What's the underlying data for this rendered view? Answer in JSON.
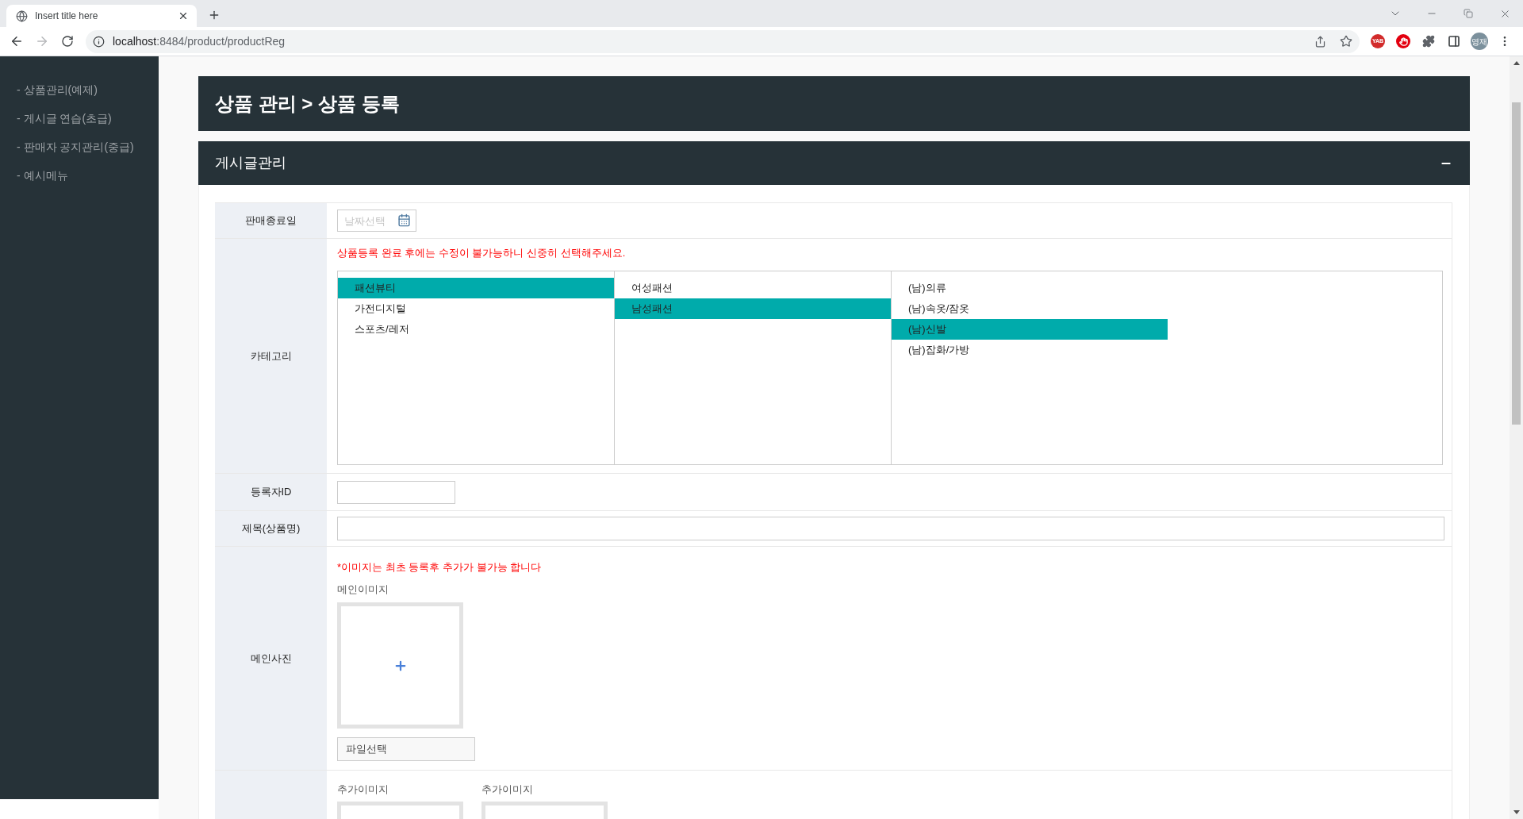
{
  "browser": {
    "tab_title": "Insert title here",
    "url_host": "localhost",
    "url_path": ":8484/product/productReg",
    "forward_disabled": true,
    "extension_badge": "YAB",
    "profile_initials": "영재"
  },
  "sidebar": {
    "items": [
      {
        "label": "- 상품관리(예제)"
      },
      {
        "label": "- 게시글 연습(초급)"
      },
      {
        "label": "- 판매자 공지관리(중급)"
      },
      {
        "label": "- 예시메뉴"
      }
    ]
  },
  "page_title": "상품 관리 > 상품 등록",
  "panel": {
    "title": "게시글관리",
    "expanded": true
  },
  "form": {
    "rows": [
      {
        "kind": "date",
        "label": "판매종료일",
        "placeholder": "날짜선택"
      },
      {
        "kind": "category",
        "label": "카테고리",
        "notice": "상품등록 완료 후에는 수정이 불가능하니 신중히 선택해주세요.",
        "columns": [
          {
            "items": [
              {
                "label": "패션뷰티",
                "selected": true
              },
              {
                "label": "가전디지털",
                "selected": false
              },
              {
                "label": "스포츠/레저",
                "selected": false
              }
            ]
          },
          {
            "items": [
              {
                "label": "여성패션",
                "selected": false
              },
              {
                "label": "남성패션",
                "selected": true
              }
            ]
          },
          {
            "items": [
              {
                "label": "(남)의류",
                "selected": false
              },
              {
                "label": "(남)속옷/잠옷",
                "selected": false
              },
              {
                "label": "(남)신발",
                "selected": true
              },
              {
                "label": "(남)잡화/가방",
                "selected": false
              }
            ]
          }
        ]
      },
      {
        "kind": "short_input",
        "label": "등록자ID"
      },
      {
        "kind": "input",
        "label": "제목(상품명)"
      },
      {
        "kind": "main_image",
        "label": "메인사진",
        "notice": "*이미지는 최초 등록후 추가가 불가능 합니다",
        "image_label": "메인이미지",
        "file_button": "파일선택"
      },
      {
        "kind": "extra_images",
        "images": [
          {
            "label": "추가이미지"
          },
          {
            "label": "추가이미지"
          }
        ]
      }
    ]
  }
}
